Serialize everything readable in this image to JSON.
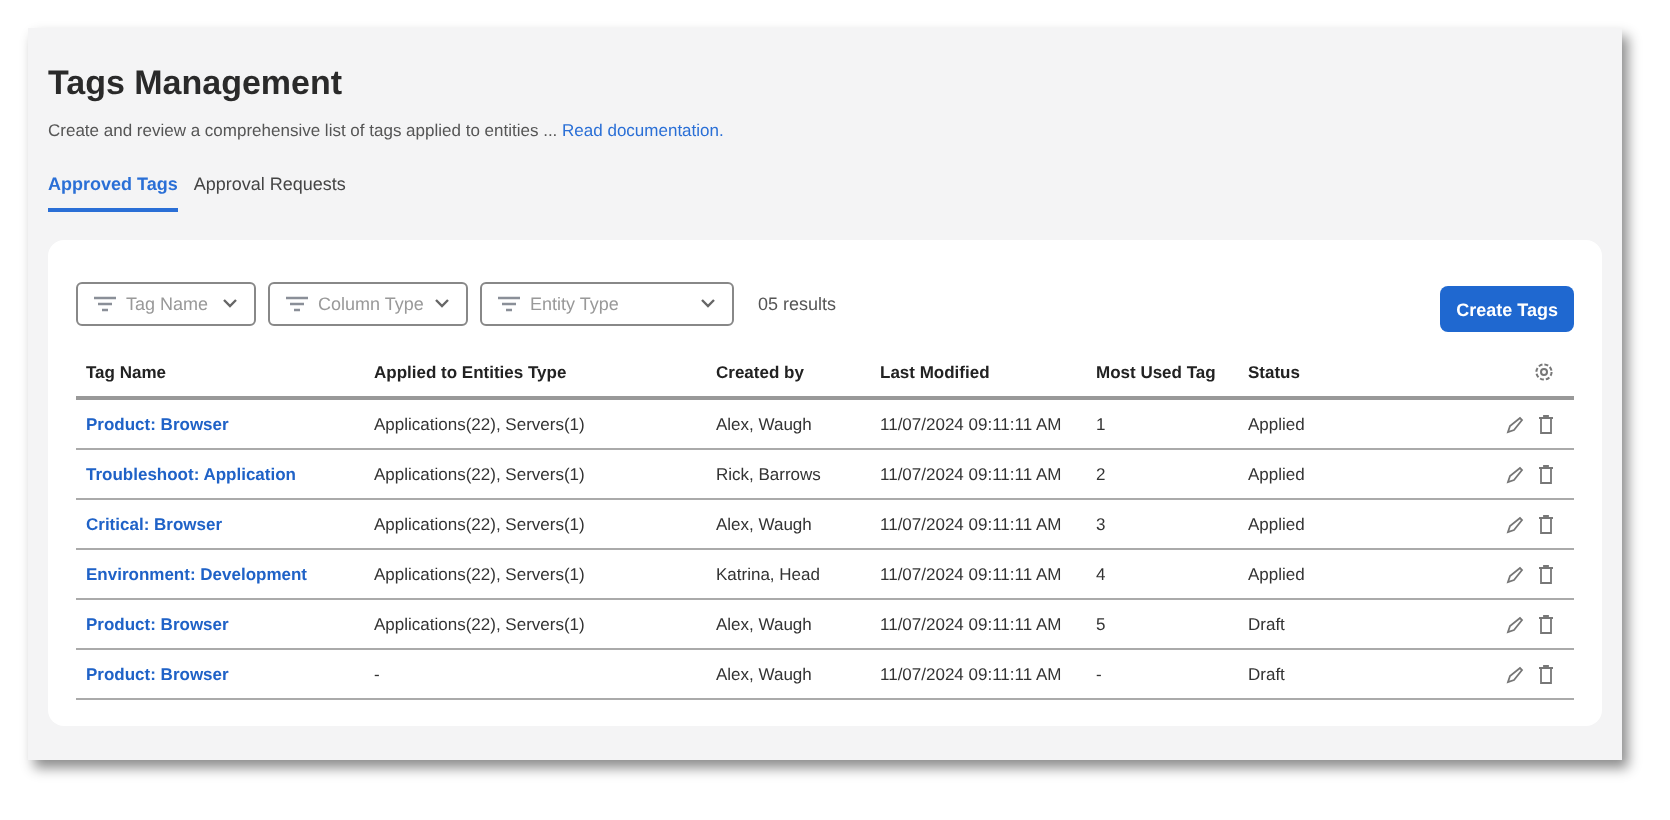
{
  "header": {
    "title": "Tags Management",
    "description": "Create and review a comprehensive list of tags applied to entities ...",
    "doc_link": "Read documentation."
  },
  "tabs": [
    {
      "label": "Approved Tags",
      "selected": true
    },
    {
      "label": "Approval Requests",
      "selected": false
    }
  ],
  "filters": [
    {
      "placeholder": "Tag Name"
    },
    {
      "placeholder": "Column Type"
    },
    {
      "placeholder": "Entity Type"
    }
  ],
  "results": "05 results",
  "create_button": "Create Tags",
  "table": {
    "columns": [
      "Tag Name",
      "Applied to Entities Type",
      "Created by",
      "Last Modified",
      "Most Used Tag",
      "Status"
    ],
    "rows": [
      [
        "Product: Browser",
        "Applications(22), Servers(1)",
        "Alex, Waugh",
        "11/07/2024 09:11:11 AM",
        "1",
        "Applied"
      ],
      [
        "Troubleshoot: Application",
        "Applications(22), Servers(1)",
        "Rick, Barrows",
        "11/07/2024 09:11:11 AM",
        "2",
        "Applied"
      ],
      [
        "Critical: Browser",
        "Applications(22), Servers(1)",
        "Alex, Waugh",
        "11/07/2024 09:11:11 AM",
        "3",
        "Applied"
      ],
      [
        "Environment: Development",
        "Applications(22), Servers(1)",
        "Katrina, Head",
        "11/07/2024 09:11:11 AM",
        "4",
        "Applied"
      ],
      [
        "Product: Browser",
        "Applications(22), Servers(1)",
        "Alex, Waugh",
        "11/07/2024 09:11:11 AM",
        "5",
        "Draft"
      ],
      [
        "Product: Browser",
        "-",
        "Alex, Waugh",
        "11/07/2024 09:11:11 AM",
        "-",
        "Draft"
      ]
    ]
  }
}
